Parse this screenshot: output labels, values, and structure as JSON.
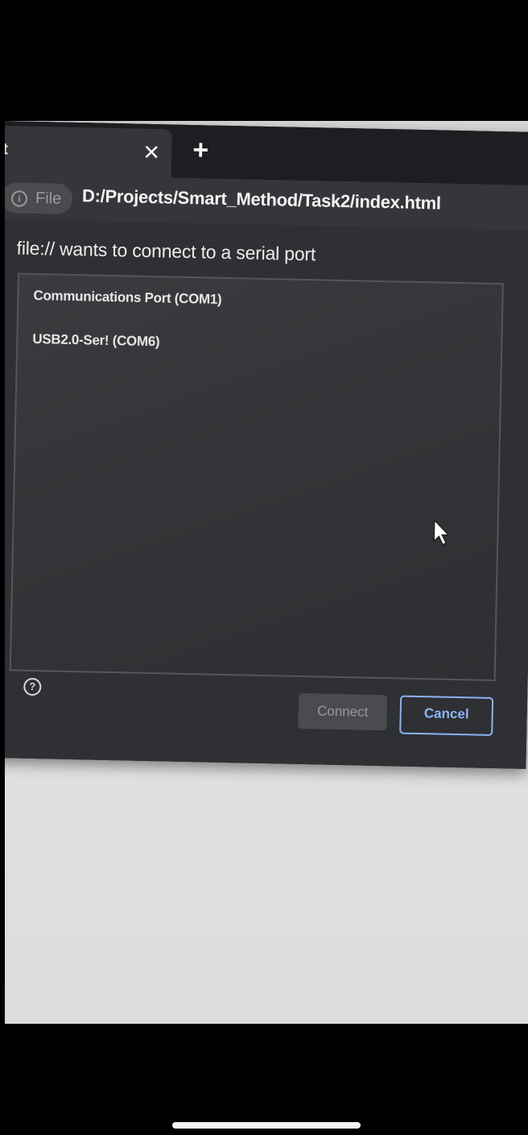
{
  "tab": {
    "title": "t",
    "close_glyph": "✕",
    "new_tab_glyph": "+"
  },
  "address": {
    "site_label": "File",
    "url": "D:/Projects/Smart_Method/Task2/index.html"
  },
  "dialog": {
    "title": "file:// wants to connect to a serial port",
    "ports": [
      {
        "label": "Communications Port (COM1)"
      },
      {
        "label": "USB2.0-Ser! (COM6)"
      }
    ],
    "connect_label": "Connect",
    "cancel_label": "Cancel",
    "connect_enabled": false
  },
  "icons": {
    "info": "info-icon",
    "help": "help-icon",
    "close": "close-icon",
    "new_tab": "plus-icon",
    "cursor": "mouse-cursor-icon"
  },
  "colors": {
    "accent": "#8ab4f8",
    "dialog_bg": "#2f3033",
    "disabled_button": "#4a4b4f"
  }
}
